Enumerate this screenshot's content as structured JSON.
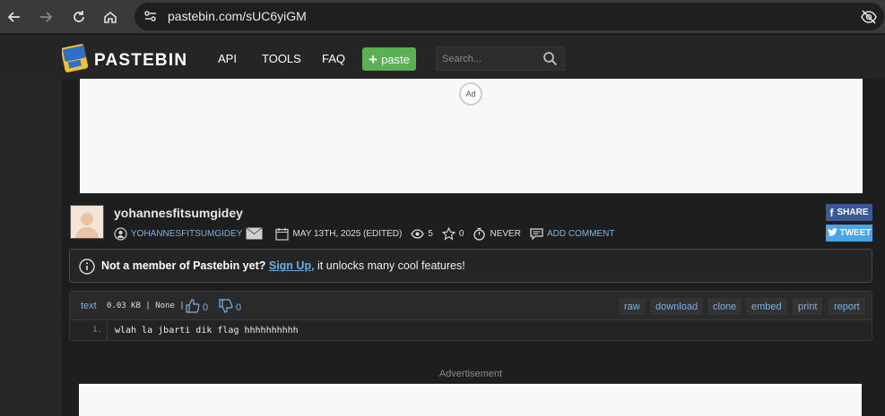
{
  "browser": {
    "url": "pastebin.com/sUC6yiGM"
  },
  "header": {
    "brand": "PASTEBIN",
    "menu": [
      "API",
      "TOOLS",
      "FAQ"
    ],
    "paste_label": "paste",
    "search_placeholder": "Search..."
  },
  "ad": {
    "badge": "Ad",
    "advertisement_label": "Advertisement"
  },
  "paste": {
    "author": "yohannesfitsumgidey",
    "author_link": "YOHANNESFITSUMGIDEY",
    "date": "MAY 13TH, 2025 (EDITED)",
    "views": "5",
    "stars": "0",
    "expiry": "NEVER",
    "add_comment": "ADD COMMENT",
    "share_label": "SHARE",
    "tweet_label": "TWEET"
  },
  "notice": {
    "prefix": "Not a member of Pastebin yet?",
    "signup": "Sign Up",
    "suffix": ", it unlocks many cool features!"
  },
  "code": {
    "syntax": "text",
    "size_info": "0.03 KB | None |",
    "likes": "0",
    "dislikes": "0",
    "tools": [
      "raw",
      "download",
      "clone",
      "embed",
      "print",
      "report"
    ],
    "lines": [
      {
        "num": "1.",
        "text": "wlah la jbarti dik flag hhhhhhhhhh"
      }
    ]
  }
}
